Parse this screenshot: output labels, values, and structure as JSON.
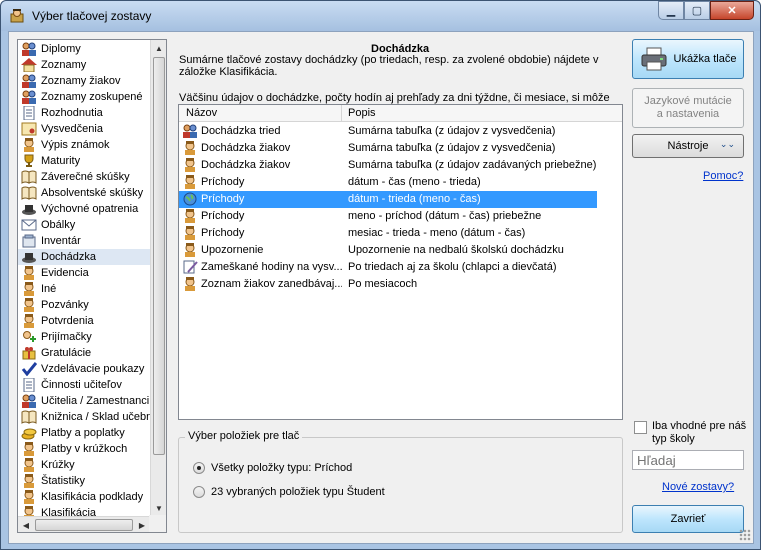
{
  "window": {
    "title": "Výber tlačovej zostavy"
  },
  "sidebar": {
    "items": [
      {
        "label": "Diplomy",
        "icon": "people-icon"
      },
      {
        "label": "Zoznamy",
        "icon": "house-icon"
      },
      {
        "label": "Zoznamy žiakov",
        "icon": "people-icon"
      },
      {
        "label": "Zoznamy zoskupené",
        "icon": "people-icon"
      },
      {
        "label": "Rozhodnutia",
        "icon": "document-icon"
      },
      {
        "label": "Vysvedčenia",
        "icon": "certificate-icon"
      },
      {
        "label": "Výpis známok",
        "icon": "person-icon"
      },
      {
        "label": "Maturity",
        "icon": "trophy-icon"
      },
      {
        "label": "Záverečné skúšky",
        "icon": "book-icon"
      },
      {
        "label": "Absolventské skúšky",
        "icon": "book-icon"
      },
      {
        "label": "Výchovné opatrenia",
        "icon": "hat-icon"
      },
      {
        "label": "Obálky",
        "icon": "envelope-icon"
      },
      {
        "label": "Inventár",
        "icon": "box-icon"
      },
      {
        "label": "Dochádzka",
        "icon": "hat-icon"
      },
      {
        "label": "Evidencia",
        "icon": "person-icon"
      },
      {
        "label": "Iné",
        "icon": "person-icon"
      },
      {
        "label": "Pozvánky",
        "icon": "person-icon"
      },
      {
        "label": "Potvrdenia",
        "icon": "person-icon"
      },
      {
        "label": "Prijímačky",
        "icon": "plus-icon"
      },
      {
        "label": "Gratulácie",
        "icon": "gift-icon"
      },
      {
        "label": "Vzdelávacie poukazy",
        "icon": "check-icon"
      },
      {
        "label": "Činnosti učiteľov",
        "icon": "document-icon"
      },
      {
        "label": "Učitelia / Zamestnanci",
        "icon": "people-icon"
      },
      {
        "label": "Knižnica / Sklad učebn",
        "icon": "book-icon"
      },
      {
        "label": "Platby a poplatky",
        "icon": "coins-icon"
      },
      {
        "label": "Platby v krúžkoch",
        "icon": "person-icon"
      },
      {
        "label": "Krúžky",
        "icon": "person-icon"
      },
      {
        "label": "Štatistiky",
        "icon": "person-icon"
      },
      {
        "label": "Klasifikácia podklady",
        "icon": "person-icon"
      },
      {
        "label": "Klasifikácia",
        "icon": "person-icon"
      }
    ],
    "selected_index": 13
  },
  "main": {
    "heading": "Dochádzka",
    "description": "Sumárne tlačové zostavy dochádzky (po triedach, resp. za zvolené obdobie) nájdete v záložke Klasifikácia.",
    "description2": "Väčšinu údajov o dochádzke, počty hodín aj prehľady za dni týždne, či mesiace, si môže",
    "columns": [
      "Názov",
      "Popis"
    ],
    "rows": [
      {
        "name": "Dochádzka tried",
        "desc": "Sumárna tabuľka (z údajov z vysvedčenia)",
        "icon": "people-icon"
      },
      {
        "name": "Dochádzka žiakov",
        "desc": "Sumárna tabuľka (z údajov z vysvedčenia)",
        "icon": "person-icon"
      },
      {
        "name": "Dochádzka žiakov",
        "desc": "Sumárna tabuľka (z údajov zadávaných priebežne)",
        "icon": "person-icon"
      },
      {
        "name": "Príchody",
        "desc": "dátum - čas (meno - trieda)",
        "icon": "person-icon"
      },
      {
        "name": "Príchody",
        "desc": "dátum - trieda (meno - čas)",
        "icon": "globe-icon"
      },
      {
        "name": "Príchody",
        "desc": "meno - príchod (dátum - čas) priebežne",
        "icon": "person-icon"
      },
      {
        "name": "Príchody",
        "desc": "mesiac - trieda - meno (dátum - čas)",
        "icon": "person-icon"
      },
      {
        "name": "Upozornenie",
        "desc": "Upozornenie na nedbalú školskú dochádzku",
        "icon": "person-icon"
      },
      {
        "name": "Zameškané hodiny na vysv...",
        "desc": "Po triedach aj za školu (chlapci a dievčatá)",
        "icon": "pencil-icon"
      },
      {
        "name": "Zoznam žiakov zanedbávaj...",
        "desc": "Po mesiacoch",
        "icon": "person-icon"
      }
    ],
    "selected_row": 4
  },
  "selection_group": {
    "title": "Výber položiek pre tlač",
    "option_all": "Všetky položky typu: Príchod",
    "option_selected": "23 vybraných položiek typu Študent",
    "checked": "all"
  },
  "right": {
    "print_preview": "Ukážka tlače",
    "language_variants": "Jazykové mutácie a nastavenia",
    "tools": "Nástroje",
    "help": "Pomoc?",
    "only_suitable": "Iba vhodné pre náš typ školy",
    "search_placeholder": "Hľadaj",
    "new_reports": "Nové zostavy?",
    "close": "Zavrieť"
  },
  "colors": {
    "selection": "#3399ff",
    "link": "#0033cc",
    "button_blue": "#bee6fd"
  }
}
